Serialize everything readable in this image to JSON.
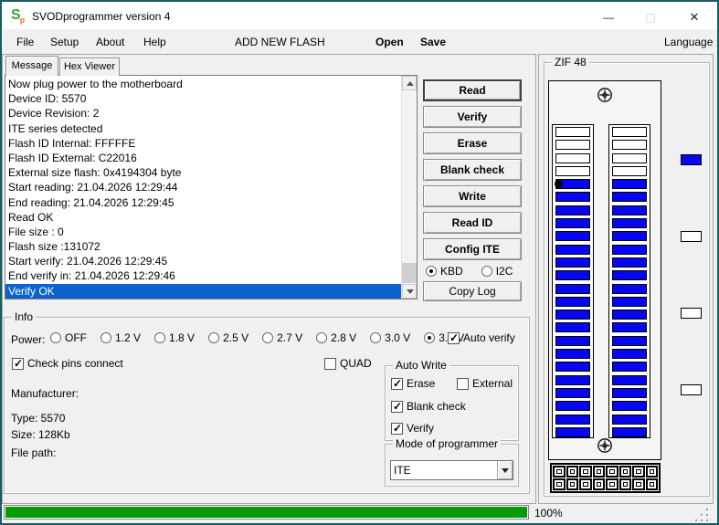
{
  "window": {
    "title": "SVODprogrammer version 4",
    "icon_text": "S",
    "icon_sub": "p",
    "minimize_glyph": "—",
    "maximize_glyph": "▢",
    "close_glyph": "✕"
  },
  "menu": {
    "items": [
      "File",
      "Setup",
      "About",
      "Help"
    ],
    "add_new_flash": "ADD NEW FLASH",
    "open": "Open",
    "save": "Save",
    "language": "Language"
  },
  "tabs": {
    "message": "Message",
    "hex_viewer": "Hex Viewer"
  },
  "log": {
    "lines": [
      "Now plug power to the motherboard",
      "Device ID: 5570",
      "Device Revision: 2",
      "ITE series detected",
      "Flash ID Internal: FFFFFE",
      "Flash ID External: C22016",
      "External size flash: 0x4194304 byte",
      "Start reading: 21.04.2026 12:29:44",
      "End reading: 21.04.2026 12:29:45",
      "Read OK",
      "File size : 0",
      "Flash size :131072",
      "Start verify: 21.04.2026 12:29:45",
      "End verify in: 21.04.2026 12:29:46",
      "Verify OK"
    ],
    "selected_index": 14
  },
  "actions": {
    "buttons": [
      "Read",
      "Verify",
      "Erase",
      "Blank check",
      "Write",
      "Read ID",
      "Config ITE"
    ],
    "default_button": "Read",
    "kbd_label": "KBD",
    "i2c_label": "I2C",
    "interface_selected": "KBD",
    "copy_log": "Copy Log"
  },
  "zif": {
    "title": "ZIF 48",
    "columns": [
      {
        "white_pins": 4,
        "blue_pins": 20,
        "pin1_marker": true
      },
      {
        "white_pins": 4,
        "blue_pins": 20,
        "pin1_marker": false
      }
    ],
    "indicator_colors": [
      "#0606f0",
      "#ffffff",
      "#ffffff",
      "#ffffff"
    ],
    "connector_cells": 16
  },
  "info": {
    "title": "Info",
    "power_label": "Power:",
    "power_options": [
      "OFF",
      "1.2 V",
      "1.8 V",
      "2.5 V",
      "2.7 V",
      "2.8 V",
      "3.0 V",
      "3.3 V"
    ],
    "power_selected": "3.3 V",
    "auto_verify_label": "Auto verify",
    "auto_verify_checked": true,
    "check_pins_label": "Check pins connect",
    "check_pins_checked": true,
    "quad_label": "QUAD",
    "quad_checked": false,
    "manufacturer_label": "Manufacturer:",
    "type_text": "Type: 5570",
    "size_text": "Size: 128Kb",
    "file_path_label": "File path:"
  },
  "auto_write": {
    "title": "Auto Write",
    "options": [
      {
        "label": "Erase",
        "checked": true
      },
      {
        "label": "External",
        "checked": false
      },
      {
        "label": "Blank check",
        "checked": true
      },
      {
        "label": "Verify",
        "checked": true
      }
    ]
  },
  "mode": {
    "title": "Mode of programmer",
    "value": "ITE"
  },
  "status": {
    "progress_percent": 100,
    "progress_text": "100%"
  },
  "colors": {
    "window_border": "#175d63",
    "accent_blue": "#0d62cf",
    "pin_blue": "#0606f0",
    "progress_green": "#089908"
  }
}
